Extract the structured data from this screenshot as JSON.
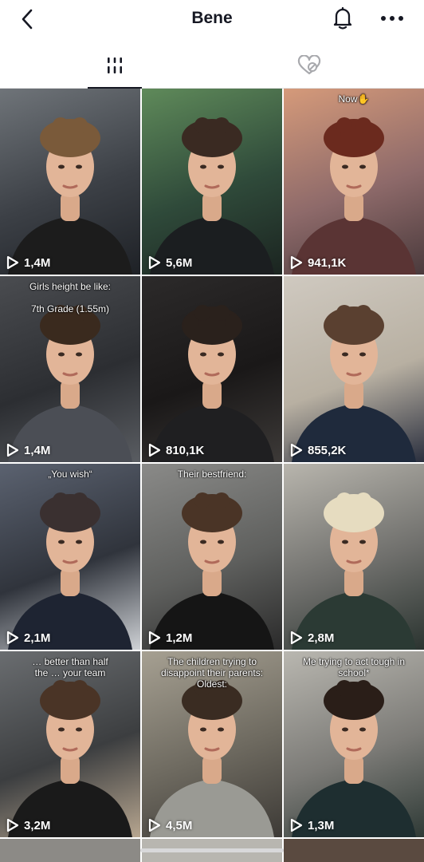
{
  "header": {
    "title": "Bene",
    "back_icon": "chevron-left-icon",
    "notification_icon": "bell-icon",
    "more_icon": "more-horizontal-icon"
  },
  "tabs": [
    {
      "name": "videos",
      "icon": "grid-bars-icon",
      "active": true
    },
    {
      "name": "liked",
      "icon": "hidden-heart-icon",
      "active": false
    }
  ],
  "colors": {
    "text": "#161823",
    "divider": "#e3e3e4",
    "indicator": "#161823"
  },
  "videos": [
    {
      "views": "1,4M",
      "overlay": ""
    },
    {
      "views": "5,6M",
      "overlay": ""
    },
    {
      "views": "941,1K",
      "overlay": "Now✋"
    },
    {
      "views": "1,4M",
      "overlay": "Girls height be like:\n\n7th Grade (1.55m)"
    },
    {
      "views": "810,1K",
      "overlay": ""
    },
    {
      "views": "855,2K",
      "overlay": ""
    },
    {
      "views": "2,1M",
      "overlay": "„You wish“"
    },
    {
      "views": "1,2M",
      "overlay": "Their bestfriend:"
    },
    {
      "views": "2,8M",
      "overlay": ""
    },
    {
      "views": "3,2M",
      "overlay": "… better than half\nthe … your team"
    },
    {
      "views": "4,5M",
      "overlay": "The children trying to\ndisappoint their parents:\nOldest:"
    },
    {
      "views": "1,3M",
      "overlay": "Me trying to act tough in\nschool*"
    }
  ]
}
